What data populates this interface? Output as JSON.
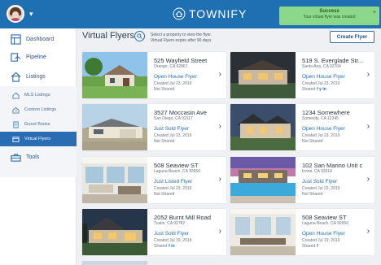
{
  "header": {
    "brand": "TOWNIFY"
  },
  "toast": {
    "title": "Success",
    "message": "Your virtual flyer was created",
    "close": "×"
  },
  "sidebar": {
    "items": [
      {
        "label": "Dashboard",
        "icon": "dashboard-icon"
      },
      {
        "label": "Pipeline",
        "icon": "pipeline-icon"
      },
      {
        "label": "Listings",
        "icon": "house-icon"
      },
      {
        "label": "Tools",
        "icon": "toolbox-icon"
      }
    ],
    "sub_items": [
      {
        "label": "MLS Listings",
        "icon": "mls-icon"
      },
      {
        "label": "Custom Listings",
        "icon": "custom-listings-icon"
      },
      {
        "label": "Guest Books",
        "icon": "guest-book-icon"
      },
      {
        "label": "Virtual Flyers",
        "icon": "virtual-flyer-icon",
        "active": true
      }
    ]
  },
  "main": {
    "title": "Virtual Flyers",
    "hint_line1": "Select a property to view the flyer.",
    "hint_line2": "Virtual Flyers expire after 90 days",
    "create_button": "Create Flyer"
  },
  "flyers": [
    {
      "address": "525 Wayfield Street",
      "city": "Orange, CA 92867",
      "type": "Open House Flyer",
      "created": "Created Jul 23, 2019",
      "shared": "Not Shared",
      "social": ""
    },
    {
      "address": "519 S. Everglade Str...",
      "city": "Santa Ana, CA 92704",
      "type": "Open House Flyer",
      "created": "Created Jul 23, 2019",
      "shared": "Shared",
      "social": "f y in"
    },
    {
      "address": "3527 Moccasin Ave",
      "city": "San Diego, CA 92117",
      "type": "Just Sold Flyer",
      "created": "Created Jul 23, 2019",
      "shared": "Not Shared",
      "social": ""
    },
    {
      "address": "1234 Somewhere",
      "city": "Somecity, CA 12345",
      "type": "Open House Flyer",
      "created": "Created Jul 23, 2019",
      "shared": "Not Shared",
      "social": ""
    },
    {
      "address": "508 Seaview ST",
      "city": "Laguna Beach, CA 92656",
      "type": "Just Listed Flyer",
      "created": "Created Jul 23, 2019",
      "shared": "Not Shared",
      "social": ""
    },
    {
      "address": "102 San Marino Unit c",
      "city": "Irvine, CA 92614",
      "type": "Just Sold Flyer",
      "created": "Created Jul 23, 2019",
      "shared": "Not Shared",
      "social": ""
    },
    {
      "address": "2052 Burnt Mill Road",
      "city": "Tustin, CA 92782",
      "type": "Just Sold Flyer",
      "created": "Created Jul 19, 2019",
      "shared": "Shared",
      "social": "f in"
    },
    {
      "address": "508 Seaview ST",
      "city": "Laguna Beach, CA 92656",
      "type": "Open House Flyer",
      "created": "Created Jul 19, 2019",
      "shared": "Shared",
      "social": "f"
    }
  ],
  "colors": {
    "brand_blue": "#1f6fb3",
    "toast_green": "#8bd88a",
    "link_blue": "#2a6db3"
  }
}
